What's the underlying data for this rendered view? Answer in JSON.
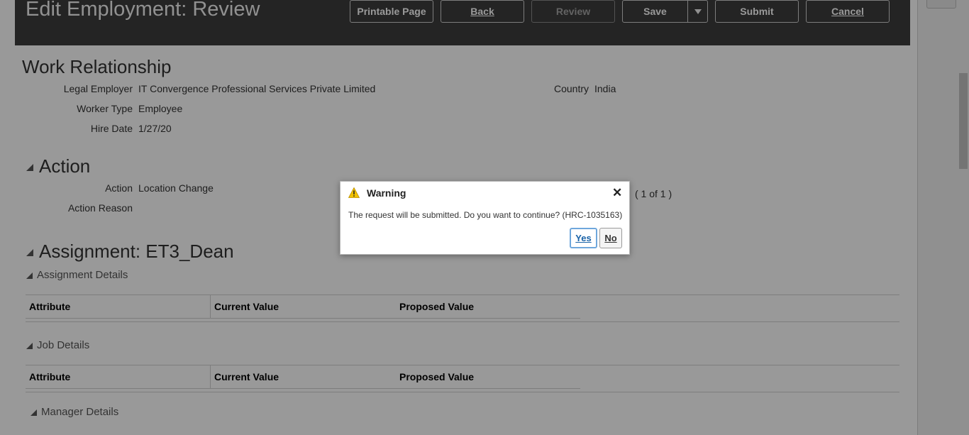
{
  "header": {
    "title": "Edit Employment: Review",
    "buttons": {
      "printable_page": "Printable Page",
      "back": "Back",
      "review": "Review",
      "save": "Save",
      "submit": "Submit",
      "cancel": "Cancel"
    }
  },
  "work_relationship": {
    "heading": "Work Relationship",
    "legal_employer_label": "Legal Employer",
    "legal_employer_value": "IT Convergence Professional Services Private Limited",
    "country_label": "Country",
    "country_value": "India",
    "worker_type_label": "Worker Type",
    "worker_type_value": "Employee",
    "hire_date_label": "Hire Date",
    "hire_date_value": "1/27/20"
  },
  "action": {
    "heading": "Action",
    "action_label": "Action",
    "action_value": "Location Change",
    "action_reason_label": "Action Reason",
    "pager": "( 1 of 1 )"
  },
  "assignment": {
    "heading": "Assignment: ET3_Dean",
    "sections": [
      {
        "title": "Assignment Details",
        "columns": [
          "Attribute",
          "Current Value",
          "Proposed Value"
        ]
      },
      {
        "title": "Job Details",
        "columns": [
          "Attribute",
          "Current Value",
          "Proposed Value"
        ]
      },
      {
        "title": "Manager Details"
      }
    ]
  },
  "dialog": {
    "title": "Warning",
    "message": "The request will be submitted. Do you want to continue? (HRC-1035163)",
    "yes": "Yes",
    "no": "No",
    "icon": "warning-icon",
    "icon_color": "#f2c200"
  },
  "colors": {
    "header_bg": "#3c3c3c",
    "overlay": "rgba(0,0,0,0.40)"
  }
}
